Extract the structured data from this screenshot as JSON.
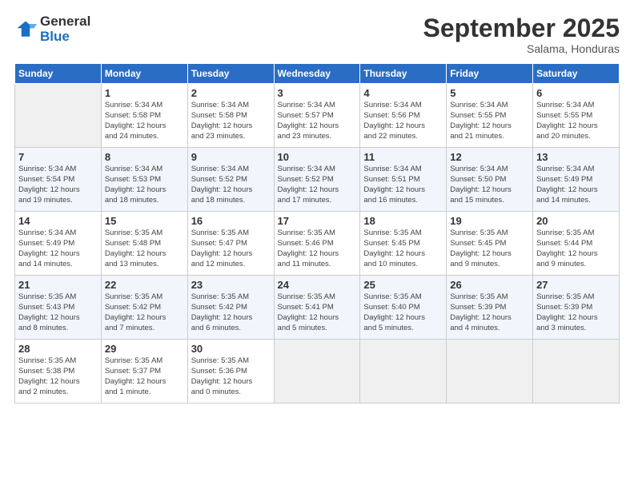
{
  "header": {
    "logo_general": "General",
    "logo_blue": "Blue",
    "month": "September 2025",
    "location": "Salama, Honduras"
  },
  "weekdays": [
    "Sunday",
    "Monday",
    "Tuesday",
    "Wednesday",
    "Thursday",
    "Friday",
    "Saturday"
  ],
  "weeks": [
    [
      {
        "day": "",
        "info": ""
      },
      {
        "day": "1",
        "info": "Sunrise: 5:34 AM\nSunset: 5:58 PM\nDaylight: 12 hours\nand 24 minutes."
      },
      {
        "day": "2",
        "info": "Sunrise: 5:34 AM\nSunset: 5:58 PM\nDaylight: 12 hours\nand 23 minutes."
      },
      {
        "day": "3",
        "info": "Sunrise: 5:34 AM\nSunset: 5:57 PM\nDaylight: 12 hours\nand 23 minutes."
      },
      {
        "day": "4",
        "info": "Sunrise: 5:34 AM\nSunset: 5:56 PM\nDaylight: 12 hours\nand 22 minutes."
      },
      {
        "day": "5",
        "info": "Sunrise: 5:34 AM\nSunset: 5:55 PM\nDaylight: 12 hours\nand 21 minutes."
      },
      {
        "day": "6",
        "info": "Sunrise: 5:34 AM\nSunset: 5:55 PM\nDaylight: 12 hours\nand 20 minutes."
      }
    ],
    [
      {
        "day": "7",
        "info": "Sunrise: 5:34 AM\nSunset: 5:54 PM\nDaylight: 12 hours\nand 19 minutes."
      },
      {
        "day": "8",
        "info": "Sunrise: 5:34 AM\nSunset: 5:53 PM\nDaylight: 12 hours\nand 18 minutes."
      },
      {
        "day": "9",
        "info": "Sunrise: 5:34 AM\nSunset: 5:52 PM\nDaylight: 12 hours\nand 18 minutes."
      },
      {
        "day": "10",
        "info": "Sunrise: 5:34 AM\nSunset: 5:52 PM\nDaylight: 12 hours\nand 17 minutes."
      },
      {
        "day": "11",
        "info": "Sunrise: 5:34 AM\nSunset: 5:51 PM\nDaylight: 12 hours\nand 16 minutes."
      },
      {
        "day": "12",
        "info": "Sunrise: 5:34 AM\nSunset: 5:50 PM\nDaylight: 12 hours\nand 15 minutes."
      },
      {
        "day": "13",
        "info": "Sunrise: 5:34 AM\nSunset: 5:49 PM\nDaylight: 12 hours\nand 14 minutes."
      }
    ],
    [
      {
        "day": "14",
        "info": "Sunrise: 5:34 AM\nSunset: 5:49 PM\nDaylight: 12 hours\nand 14 minutes."
      },
      {
        "day": "15",
        "info": "Sunrise: 5:35 AM\nSunset: 5:48 PM\nDaylight: 12 hours\nand 13 minutes."
      },
      {
        "day": "16",
        "info": "Sunrise: 5:35 AM\nSunset: 5:47 PM\nDaylight: 12 hours\nand 12 minutes."
      },
      {
        "day": "17",
        "info": "Sunrise: 5:35 AM\nSunset: 5:46 PM\nDaylight: 12 hours\nand 11 minutes."
      },
      {
        "day": "18",
        "info": "Sunrise: 5:35 AM\nSunset: 5:45 PM\nDaylight: 12 hours\nand 10 minutes."
      },
      {
        "day": "19",
        "info": "Sunrise: 5:35 AM\nSunset: 5:45 PM\nDaylight: 12 hours\nand 9 minutes."
      },
      {
        "day": "20",
        "info": "Sunrise: 5:35 AM\nSunset: 5:44 PM\nDaylight: 12 hours\nand 9 minutes."
      }
    ],
    [
      {
        "day": "21",
        "info": "Sunrise: 5:35 AM\nSunset: 5:43 PM\nDaylight: 12 hours\nand 8 minutes."
      },
      {
        "day": "22",
        "info": "Sunrise: 5:35 AM\nSunset: 5:42 PM\nDaylight: 12 hours\nand 7 minutes."
      },
      {
        "day": "23",
        "info": "Sunrise: 5:35 AM\nSunset: 5:42 PM\nDaylight: 12 hours\nand 6 minutes."
      },
      {
        "day": "24",
        "info": "Sunrise: 5:35 AM\nSunset: 5:41 PM\nDaylight: 12 hours\nand 5 minutes."
      },
      {
        "day": "25",
        "info": "Sunrise: 5:35 AM\nSunset: 5:40 PM\nDaylight: 12 hours\nand 5 minutes."
      },
      {
        "day": "26",
        "info": "Sunrise: 5:35 AM\nSunset: 5:39 PM\nDaylight: 12 hours\nand 4 minutes."
      },
      {
        "day": "27",
        "info": "Sunrise: 5:35 AM\nSunset: 5:39 PM\nDaylight: 12 hours\nand 3 minutes."
      }
    ],
    [
      {
        "day": "28",
        "info": "Sunrise: 5:35 AM\nSunset: 5:38 PM\nDaylight: 12 hours\nand 2 minutes."
      },
      {
        "day": "29",
        "info": "Sunrise: 5:35 AM\nSunset: 5:37 PM\nDaylight: 12 hours\nand 1 minute."
      },
      {
        "day": "30",
        "info": "Sunrise: 5:35 AM\nSunset: 5:36 PM\nDaylight: 12 hours\nand 0 minutes."
      },
      {
        "day": "",
        "info": ""
      },
      {
        "day": "",
        "info": ""
      },
      {
        "day": "",
        "info": ""
      },
      {
        "day": "",
        "info": ""
      }
    ]
  ]
}
